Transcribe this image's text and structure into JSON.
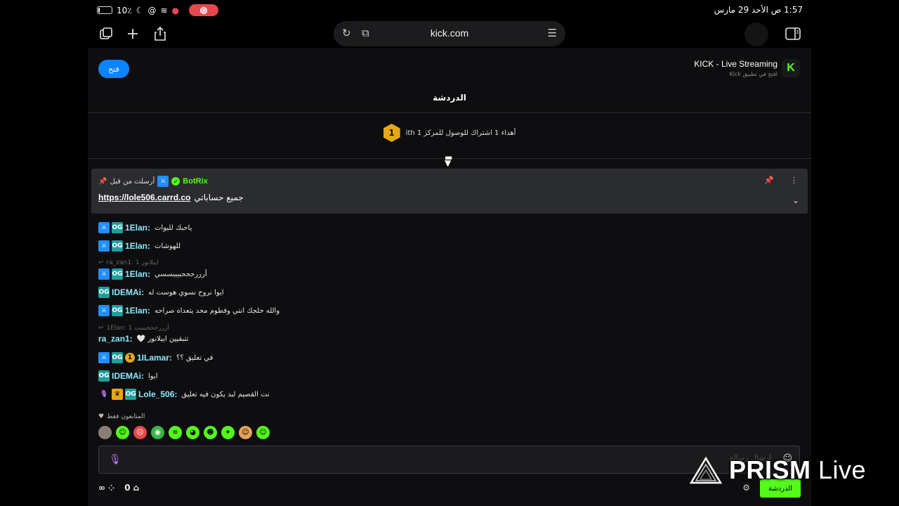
{
  "status_bar": {
    "battery": "10٪",
    "battery_level": 0.1,
    "datetime": "1:57 ص  الأحد 29 مارس"
  },
  "browser": {
    "url": "kick.com"
  },
  "app_banner": {
    "open_label": "فتح",
    "app_name": "KICK - Live Streaming",
    "app_sub": "افتح في تطبيق Kick",
    "logo_letter": "K"
  },
  "chat": {
    "title": "الدردشة",
    "gift_text": "أهداء 1 اشتراك للوصول للمركز 1 ith",
    "gift_rank": "1",
    "pinned": {
      "meta": "أرسلت من قبل",
      "user": "BotRix",
      "message_prefix": "جميع حساباتي",
      "link": "https://lole506.carrd.co"
    },
    "messages": [
      {
        "user": "1Elan:",
        "text": "ياحبك للبوات"
      },
      {
        "user": "1Elan:",
        "text": "للهوشات"
      },
      {
        "user": "1Elan:",
        "text": "أرررحححببببسسي"
      },
      {
        "user": "IDEMAi:",
        "text": "ايوا نروح نسوي هوست له"
      },
      {
        "user": "1Elan:",
        "text": "والله حلجك انتي وفطوم محد يتعداه صراحه"
      },
      {
        "user": "ra_zan1:",
        "text": "تتبقيين ايبلانور 🤍"
      },
      {
        "user": "1ILamar:",
        "text": "في تعليق ؟؟"
      },
      {
        "user": "IDEMAi:",
        "text": "ايوا"
      },
      {
        "user": "Lole_506:",
        "text": "نت القصيم لبد يكون فيه تعليق"
      }
    ],
    "replies": [
      {
        "text": "ra_zan1: ايبلانور 1"
      },
      {
        "text": "1Elan: أرررحححبببب 1"
      }
    ],
    "followers_only": "المتابعون فقط",
    "input_placeholder": "إرسال رسالة",
    "bottom_count": "0",
    "send_label": "الدردشة"
  },
  "watermark": {
    "brand": "PRISM",
    "suffix": "Live"
  }
}
